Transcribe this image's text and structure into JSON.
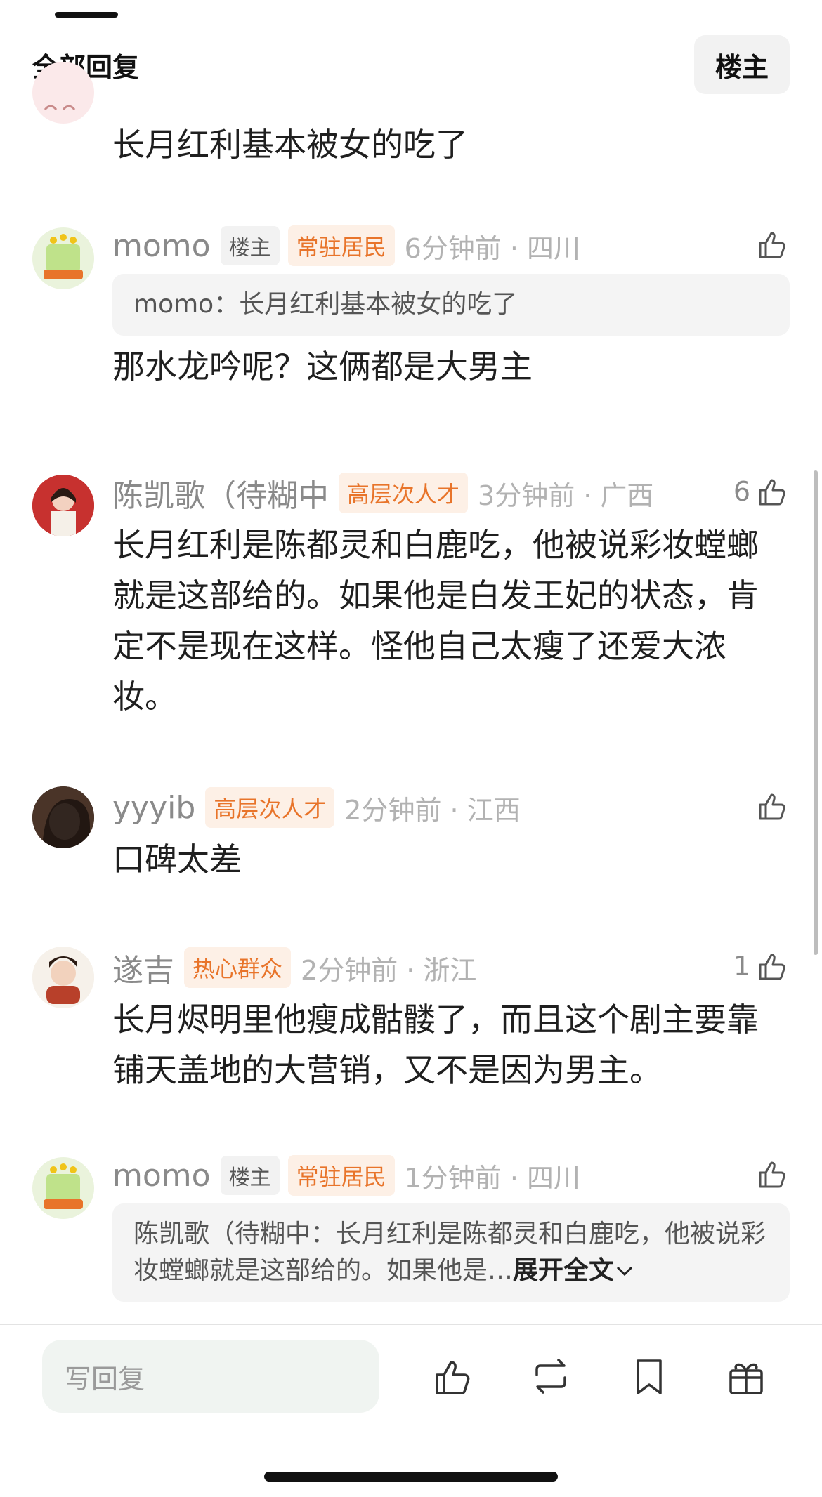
{
  "header": {
    "title": "全部回复",
    "filter_label": "楼主"
  },
  "comments": [
    {
      "text": "长月红利基本被女的吃了"
    },
    {
      "name": "momo",
      "op_tag": "楼主",
      "badge": "常驻居民",
      "time": "6分钟前 · 四川",
      "quote": "momo：长月红利基本被女的吃了",
      "text": "那水龙吟呢？这俩都是大男主",
      "likes": ""
    },
    {
      "name": "陈凯歌（待糊中",
      "badge": "高层次人才",
      "time": "3分钟前 · 广西",
      "text": "长月红利是陈都灵和白鹿吃，他被说彩妆螳螂就是这部给的。如果他是白发王妃的状态，肯定不是现在这样。怪他自己太瘦了还爱大浓妆。",
      "likes": "6"
    },
    {
      "name": "yyyib",
      "badge": "高层次人才",
      "time": "2分钟前 · 江西",
      "text": "口碑太差",
      "likes": ""
    },
    {
      "name": "遂吉",
      "badge": "热心群众",
      "time": "2分钟前 · 浙江",
      "text": "长月烬明里他瘦成骷髅了，而且这个剧主要靠铺天盖地的大营销，又不是因为男主。",
      "likes": "1"
    },
    {
      "name": "momo",
      "op_tag": "楼主",
      "badge": "常驻居民",
      "time": "1分钟前 · 四川",
      "quote": "陈凯歌（待糊中：长月红利是陈都灵和白鹿吃，他被说彩妆螳螂就是这部给的。如果他是…",
      "expand_label": "展开全文",
      "likes": ""
    }
  ],
  "bottom_bar": {
    "reply_placeholder": "写回复"
  },
  "colors": {
    "badge_orange": "#e8742a",
    "badge_bg": "#fdf0e6",
    "meta_gray": "#b2b2b2"
  },
  "icons": [
    "thumbs-up-icon",
    "repost-icon",
    "bookmark-icon",
    "gift-icon",
    "chevron-down-icon"
  ]
}
